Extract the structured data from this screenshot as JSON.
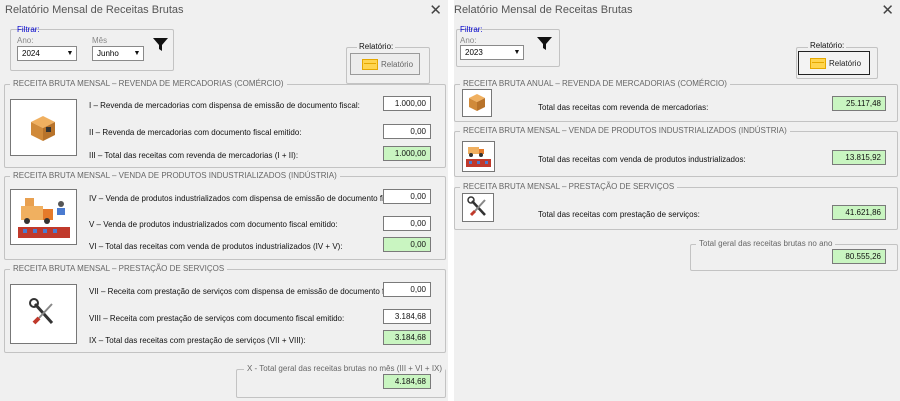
{
  "left": {
    "title": "Relatório Mensal de Receitas Brutas",
    "filter": {
      "title": "Filtrar:",
      "year_label": "Ano:",
      "year_value": "2024",
      "month_label": "Mês",
      "month_value": "Junho"
    },
    "report": {
      "group_label": "Relatório:",
      "button_label": "Relatório"
    },
    "section1": {
      "legend": "RECEITA BRUTA MENSAL – REVENDA DE MERCADORIAS (COMÉRCIO)",
      "rows": [
        {
          "label": "I – Revenda de mercadorias com dispensa de emissão de documento fiscal:",
          "value": "1.000,00"
        },
        {
          "label": "II – Revenda de mercadorias com documento fiscal emitido:",
          "value": "0,00"
        },
        {
          "label": "III – Total das receitas com revenda de mercadorias (I + II):",
          "value": "1.000,00"
        }
      ]
    },
    "section2": {
      "legend": "RECEITA BRUTA MENSAL – VENDA DE PRODUTOS INDUSTRIALIZADOS (INDÚSTRIA)",
      "rows": [
        {
          "label": "IV – Venda de produtos industrializados com dispensa de emissão de documento fiscal:",
          "value": "0,00"
        },
        {
          "label": "V – Venda de produtos industrializados com documento fiscal emitido:",
          "value": "0,00"
        },
        {
          "label": "VI – Total das receitas com venda de produtos industrializados (IV + V):",
          "value": "0,00"
        }
      ]
    },
    "section3": {
      "legend": "RECEITA BRUTA MENSAL – PRESTAÇÃO DE SERVIÇOS",
      "rows": [
        {
          "label": "VII – Receita com prestação de serviços com dispensa de emissão de documento fiscal:",
          "value": "0,00"
        },
        {
          "label": "VIII – Receita com prestação de serviços com documento fiscal emitido:",
          "value": "3.184,68"
        },
        {
          "label": "IX – Total das receitas com prestação de serviços (VII + VIII):",
          "value": "3.184,68"
        }
      ]
    },
    "total": {
      "legend": "X - Total geral das receitas brutas no mês (III + VI + IX)",
      "value": "4.184,68"
    }
  },
  "right": {
    "title": "Relatório Mensal de Receitas Brutas",
    "filter": {
      "title": "Filtrar:",
      "year_label": "Ano:",
      "year_value": "2023"
    },
    "report": {
      "group_label": "Relatório:",
      "button_label": "Relatório"
    },
    "section1": {
      "legend": "RECEITA BRUTA ANUAL – REVENDA DE MERCADORIAS (COMÉRCIO)",
      "label": "Total das receitas com revenda de mercadorias:",
      "value": "25.117,48"
    },
    "section2": {
      "legend": "RECEITA BRUTA MENSAL – VENDA DE PRODUTOS INDUSTRIALIZADOS (INDÚSTRIA)",
      "label": "Total das receitas com venda de produtos industrializados:",
      "value": "13.815,92"
    },
    "section3": {
      "legend": "RECEITA BRUTA MENSAL – PRESTAÇÃO DE SERVIÇOS",
      "label": "Total das receitas com prestação de serviços:",
      "value": "41.621,86"
    },
    "total": {
      "legend": "Total geral das receitas brutas no ano",
      "value": "80.555,26"
    }
  },
  "icons": {
    "close": "close-icon",
    "filter": "funnel-filter-icon",
    "report": "report-folder-icon",
    "commerce": "package-box-icon",
    "industry": "factory-truck-icon",
    "services": "wrench-screwdriver-icon",
    "dropdown": "chevron-down-icon"
  },
  "colors": {
    "total_field": "#c9f5c1",
    "filter_label": "#0000cc",
    "report_icon": "#ffd54f"
  }
}
